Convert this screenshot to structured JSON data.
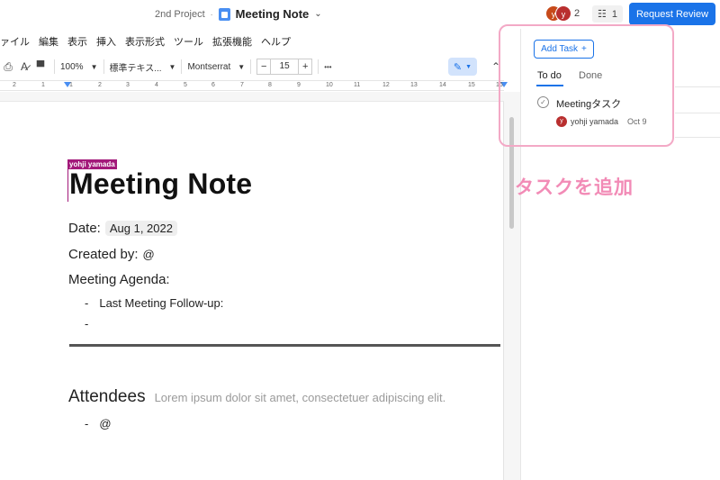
{
  "header": {
    "project": "2nd Project",
    "separator": "·",
    "doc_title": "Meeting Note",
    "avatars": [
      "y",
      "y"
    ],
    "collaborator_count": "2",
    "task_count": "1",
    "review_button": "Request Review"
  },
  "menu": [
    "ァイル",
    "編集",
    "表示",
    "挿入",
    "表示形式",
    "ツール",
    "拡張機能",
    "ヘルプ"
  ],
  "toolbar": {
    "zoom": "100%",
    "style": "標準テキス...",
    "font": "Montserrat",
    "font_size": "15",
    "minus": "−",
    "plus": "+",
    "more": "•••"
  },
  "ruler": {
    "numbers": [
      "2",
      "1",
      "1",
      "2",
      "3",
      "4",
      "5",
      "6",
      "7",
      "8",
      "9",
      "10",
      "11",
      "12",
      "13",
      "14",
      "15",
      "16"
    ]
  },
  "document": {
    "author_flag": "yohji yamada",
    "title": "Meeting Note",
    "date_label": "Date:",
    "date_value": "Aug 1, 2022",
    "created_by_label": "Created by:",
    "created_by_value": "@",
    "agenda_label": "Meeting Agenda:",
    "agenda_items": [
      "Last Meeting Follow-up:",
      ""
    ],
    "bullet_char": "-",
    "attendees_title": "Attendees",
    "attendees_placeholder": "Lorem ipsum dolor sit amet, consectetuer adipiscing elit.",
    "attendees_items": [
      "@"
    ]
  },
  "tasks_panel": {
    "add_task_label": "Add Task",
    "add_task_plus": "+",
    "tabs": [
      "To do",
      "Done"
    ],
    "active_tab": "To do",
    "tasks": [
      {
        "title": "Meetingタスク",
        "assignee_initial": "y",
        "assignee": "yohji yamada",
        "due": "Oct 9"
      }
    ]
  },
  "annotation": {
    "text": "タスクを追加",
    "color": "#f28bb6"
  },
  "colors": {
    "accent": "#1a73e8",
    "author_flag": "#a3197a",
    "highlight_box": "#f3a9c6"
  }
}
